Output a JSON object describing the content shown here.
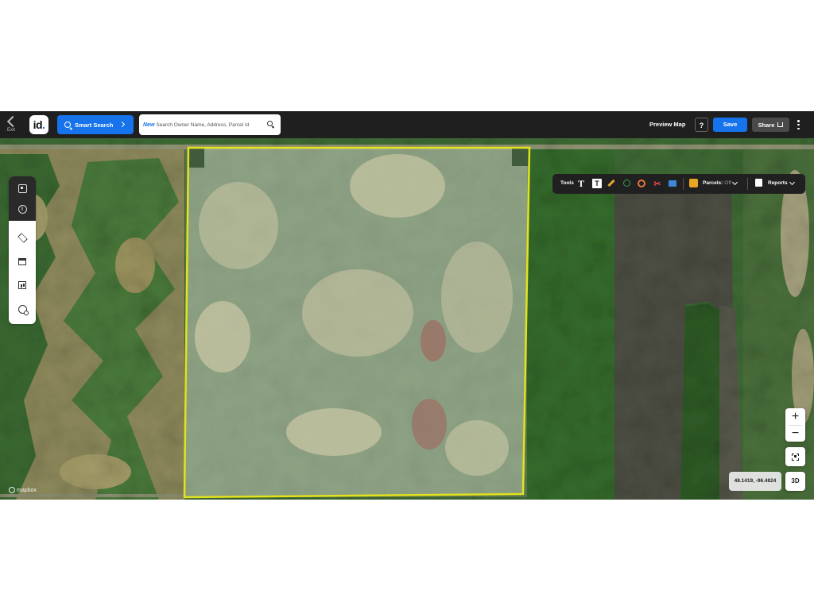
{
  "header": {
    "exit_label": "Exit",
    "logo_text": "id",
    "smart_search_label": "Smart Search",
    "search_badge": "New",
    "search_placeholder": "Search Owner Name, Address, Parcel Id",
    "preview_map_label": "Preview Map",
    "help_label": "?",
    "save_label": "Save",
    "share_label": "Share"
  },
  "tools": {
    "label": "Tools",
    "text_glyph": "T",
    "textbox_glyph": "T",
    "scissors_glyph": "✂",
    "parcels_label": "Parcels:",
    "parcels_state": "Off",
    "reports_label": "Reports"
  },
  "map": {
    "coordinates": "48.1419, -96.4824",
    "zoom_in": "+",
    "zoom_out": "−",
    "three_d_label": "3D",
    "attribution": "mapbox"
  },
  "colors": {
    "accent": "#1773ec",
    "topbar": "#1f1f1f",
    "parcel_outline": "#e3e21d"
  }
}
